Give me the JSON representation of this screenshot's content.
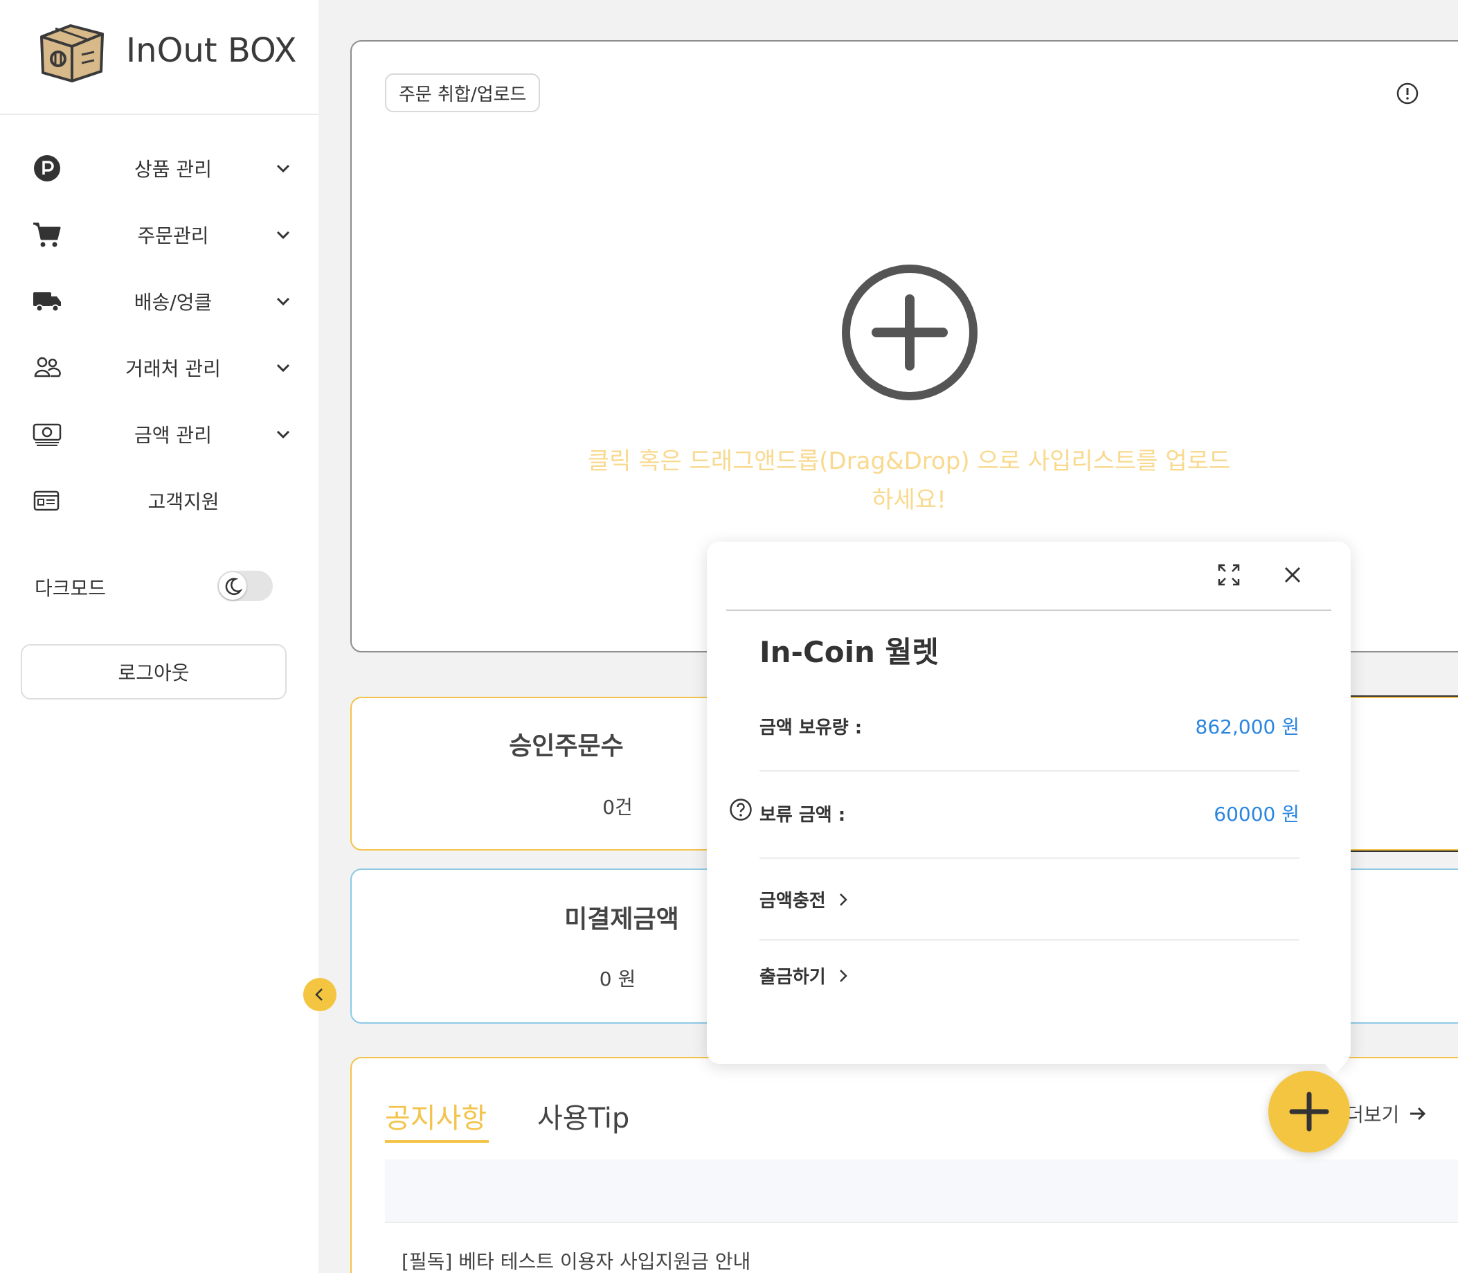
{
  "brand": {
    "title": "InOut BOX"
  },
  "sidebar": {
    "items": [
      {
        "label": "상품 관리",
        "icon": "parking-icon",
        "has_chevron": true
      },
      {
        "label": "주문관리",
        "icon": "cart-icon",
        "has_chevron": true
      },
      {
        "label": "배송/엉클",
        "icon": "truck-icon",
        "has_chevron": true
      },
      {
        "label": "거래처 관리",
        "icon": "users-icon",
        "has_chevron": true
      },
      {
        "label": "금액 관리",
        "icon": "money-icon",
        "has_chevron": true
      },
      {
        "label": "고객지원",
        "icon": "support-card-icon",
        "has_chevron": false
      }
    ],
    "darkmode_label": "다크모드",
    "darkmode_on": false,
    "logout_label": "로그아웃"
  },
  "upload": {
    "tag": "주문 취합/업로드",
    "hint": "클릭 혹은 드래그앤드롭(Drag&Drop) 으로 사입리스트를 업로드하세요!"
  },
  "stats": {
    "approved": {
      "title": "승인주문수",
      "value": "0건"
    },
    "unpaid": {
      "title": "미결제금액",
      "value": "0 원"
    }
  },
  "notice": {
    "tabs": [
      "공지사항",
      "사용Tip"
    ],
    "active_tab": "공지사항",
    "more_label": "더보기",
    "rows": [
      "[필독] 베타 테스트 이용자 사입지원금 안내"
    ]
  },
  "wallet": {
    "title": "In-Coin 월렛",
    "balance_label": "금액 보유량 :",
    "balance_value": "862,000 원",
    "hold_label": "보류 금액 :",
    "hold_value": "60000 원",
    "charge_label": "금액충전",
    "withdraw_label": "출금하기"
  },
  "colors": {
    "accent": "#f4c541",
    "link_blue": "#2a86e0",
    "hint": "#f8d98e",
    "unpaid_border": "#8cc9e6"
  }
}
